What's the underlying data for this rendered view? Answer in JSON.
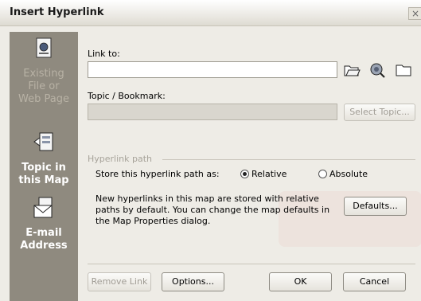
{
  "dialog": {
    "title": "Insert Hyperlink",
    "close_glyph": "×"
  },
  "sidebar": {
    "items": [
      {
        "label": "Existing File or Web Page",
        "icon": "document-icon",
        "state": "disabled"
      },
      {
        "label": "Topic in this Map",
        "icon": "topic-map-icon",
        "state": "selected"
      },
      {
        "label": "E-mail Address",
        "icon": "email-icon",
        "state": "normal"
      }
    ]
  },
  "link_to": {
    "label": "Link to:",
    "value": ""
  },
  "topic": {
    "label": "Topic / Bookmark:",
    "value": "",
    "select_button": "Select Topic..."
  },
  "path": {
    "group_label": "Hyperlink path",
    "store_label": "Store this hyperlink path as:",
    "relative_label": "Relative",
    "absolute_label": "Absolute",
    "selected": "Relative",
    "info": "New hyperlinks in this map are stored with relative paths by default. You can change the map defaults in the Map Properties dialog.",
    "defaults_button": "Defaults..."
  },
  "buttons": {
    "remove_link": "Remove Link",
    "options": "Options...",
    "ok": "OK",
    "cancel": "Cancel"
  },
  "colors": {
    "sidebar": "#8f8a7f",
    "dialog_bg": "#eeece6"
  }
}
